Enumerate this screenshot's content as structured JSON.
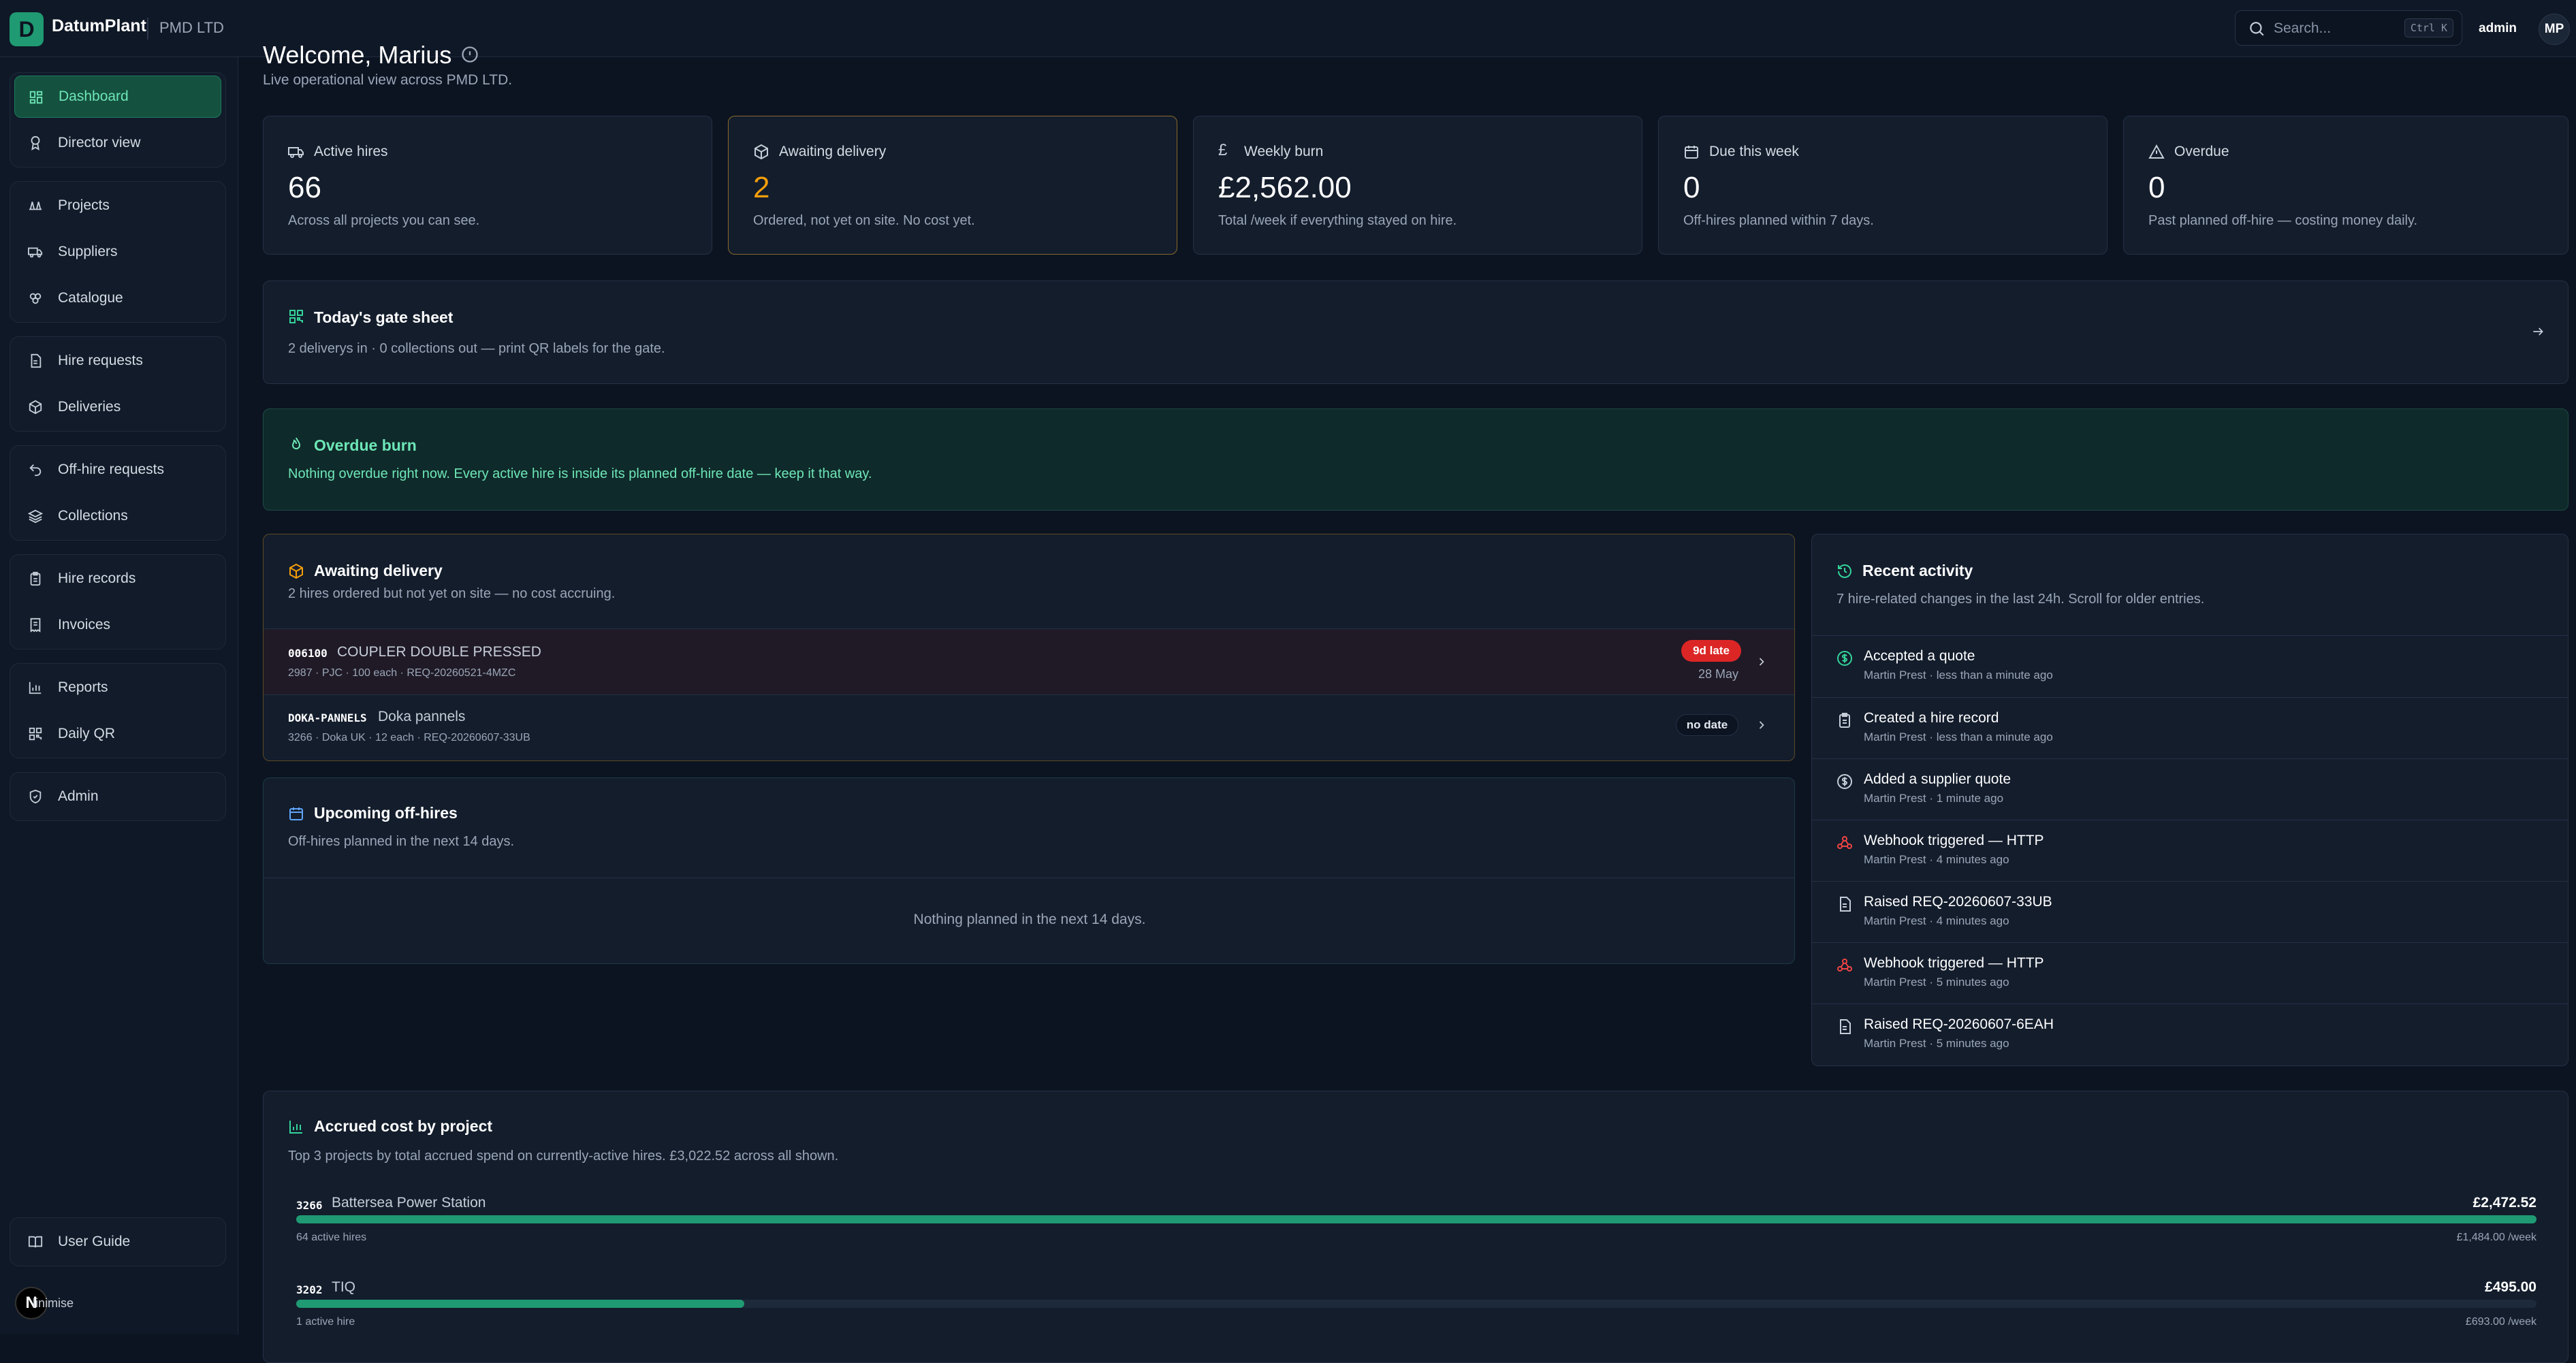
{
  "app": {
    "logo_letter": "D",
    "name": "DatumPlant",
    "org": "PMD LTD"
  },
  "search": {
    "placeholder": "Search...",
    "shortcut": "Ctrl K"
  },
  "user": {
    "role": "admin",
    "initials": "MP"
  },
  "sidebar": {
    "groups": [
      [
        {
          "label": "Dashboard",
          "icon": "dashboard-icon",
          "active": true
        },
        {
          "label": "Director view",
          "icon": "award-icon"
        }
      ],
      [
        {
          "label": "Projects",
          "icon": "cones-icon"
        },
        {
          "label": "Suppliers",
          "icon": "truck-icon"
        },
        {
          "label": "Catalogue",
          "icon": "layers-icon"
        }
      ],
      [
        {
          "label": "Hire requests",
          "icon": "document-icon"
        },
        {
          "label": "Deliveries",
          "icon": "package-icon"
        }
      ],
      [
        {
          "label": "Off-hire requests",
          "icon": "undo-icon"
        },
        {
          "label": "Collections",
          "icon": "stack-icon"
        }
      ],
      [
        {
          "label": "Hire records",
          "icon": "clipboard-icon"
        },
        {
          "label": "Invoices",
          "icon": "receipt-icon"
        }
      ],
      [
        {
          "label": "Reports",
          "icon": "chart-icon"
        },
        {
          "label": "Daily QR",
          "icon": "qr-icon"
        }
      ],
      [
        {
          "label": "Admin",
          "icon": "shield-icon"
        }
      ]
    ],
    "user_guide": "User Guide",
    "minimise": "linimise",
    "n_badge": "N"
  },
  "header": {
    "welcome": "Welcome, Marius",
    "subtitle": "Live operational view across PMD LTD."
  },
  "stats": [
    {
      "label": "Active hires",
      "value": "66",
      "desc": "Across all projects you can see.",
      "icon": "truck-icon"
    },
    {
      "label": "Awaiting delivery",
      "value": "2",
      "desc": "Ordered, not yet on site. No cost yet.",
      "icon": "package-icon",
      "highlight": "#f59e0b"
    },
    {
      "label": "Weekly burn",
      "value": "£2,562.00",
      "desc": "Total /week if everything stayed on hire.",
      "icon": "pound-icon",
      "icon_text": "£"
    },
    {
      "label": "Due this week",
      "value": "0",
      "desc": "Off-hires planned within 7 days.",
      "icon": "calendar-icon"
    },
    {
      "label": "Overdue",
      "value": "0",
      "desc": "Past planned off-hire — costing money daily.",
      "icon": "warning-icon"
    }
  ],
  "gate_sheet": {
    "title": "Today's gate sheet",
    "desc": "2 deliverys in · 0 collections out — print QR labels for the gate."
  },
  "overdue_burn": {
    "title": "Overdue burn",
    "desc": "Nothing overdue right now. Every active hire is inside its planned off-hire date — keep it that way."
  },
  "awaiting": {
    "title": "Awaiting delivery",
    "subtitle": "2 hires ordered but not yet on site — no cost accruing.",
    "rows": [
      {
        "code": "006100",
        "name": "COUPLER DOUBLE PRESSED",
        "meta": "2987 · PJC · 100 each · REQ-20260521-4MZC",
        "badge": "9d late",
        "date": "28 May"
      },
      {
        "code": "DOKA-PANNELS",
        "name": "Doka pannels",
        "meta": "3266 · Doka UK · 12 each · REQ-20260607-33UB",
        "badge": "no date",
        "date": ""
      }
    ]
  },
  "upcoming": {
    "title": "Upcoming off-hires",
    "subtitle": "Off-hires planned in the next 14 days.",
    "empty": "Nothing planned in the next 14 days."
  },
  "activity": {
    "title": "Recent activity",
    "subtitle": "7 hire-related changes in the last 24h. Scroll for older entries.",
    "items": [
      {
        "title": "Accepted a quote",
        "meta": "Martin Prest · less than a minute ago",
        "icon": "dollar-icon"
      },
      {
        "title": "Created a hire record",
        "meta": "Martin Prest · less than a minute ago",
        "icon": "clipboard-icon"
      },
      {
        "title": "Added a supplier quote",
        "meta": "Martin Prest · 1 minute ago",
        "icon": "dollar-icon"
      },
      {
        "title": "Webhook triggered — HTTP",
        "meta": "Martin Prest · 4 minutes ago",
        "icon": "webhook-icon"
      },
      {
        "title": "Raised REQ-20260607-33UB",
        "meta": "Martin Prest · 4 minutes ago",
        "icon": "document-icon"
      },
      {
        "title": "Webhook triggered — HTTP",
        "meta": "Martin Prest · 5 minutes ago",
        "icon": "webhook-icon"
      },
      {
        "title": "Raised REQ-20260607-6EAH",
        "meta": "Martin Prest · 5 minutes ago",
        "icon": "document-icon"
      }
    ]
  },
  "accrued": {
    "title": "Accrued cost by project",
    "subtitle": "Top 3 projects by total accrued spend on currently-active hires. £3,022.52 across all shown.",
    "projects": [
      {
        "code": "3266",
        "name": "Battersea Power Station",
        "amount": "£2,472.52",
        "hires": "64 active hires",
        "weekly": "£1,484.00 /week",
        "fraction": 1.0
      },
      {
        "code": "3202",
        "name": "TIQ",
        "amount": "£495.00",
        "hires": "1 active hire",
        "weekly": "£693.00 /week",
        "fraction": 0.2
      }
    ]
  },
  "colors": {
    "accent": "#1f9a73",
    "warning": "#f59e0b",
    "danger": "#dc2626",
    "bg": "#0c1421"
  }
}
